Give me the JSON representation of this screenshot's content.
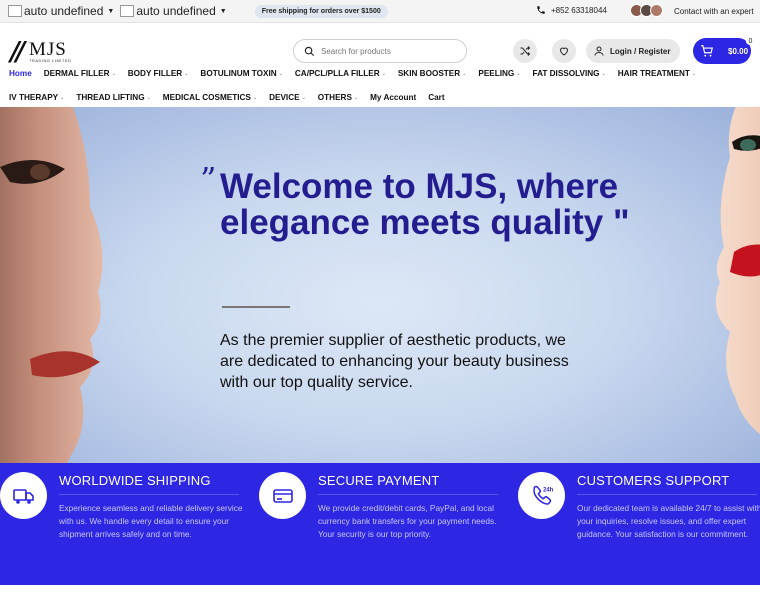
{
  "topbar": {
    "lang1": "auto undefined",
    "lang2": "auto undefined",
    "promo": "Free shipping for orders over $1500",
    "phone": "+852 63318044",
    "contact": "Contact with an expert"
  },
  "header": {
    "logo_name": "MJS",
    "logo_sub": "TRADING LIMITED",
    "search_placeholder": "Search for products",
    "login_label": "Login / Register",
    "cart_amount": "$0.00",
    "cart_count": "0"
  },
  "nav": {
    "row1": [
      {
        "label": "Home",
        "active": true,
        "has_dropdown": false
      },
      {
        "label": "DERMAL FILLER",
        "has_dropdown": true
      },
      {
        "label": "BODY FILLER",
        "has_dropdown": true
      },
      {
        "label": "BOTULINUM TOXIN",
        "has_dropdown": true
      },
      {
        "label": "CA/PCL/PLLA FILLER",
        "has_dropdown": true
      },
      {
        "label": "SKIN BOOSTER",
        "has_dropdown": true
      },
      {
        "label": "PEELING",
        "has_dropdown": true
      },
      {
        "label": "FAT DISSOLVING",
        "has_dropdown": true
      },
      {
        "label": "HAIR TREATMENT",
        "has_dropdown": true
      }
    ],
    "row2": [
      {
        "label": "IV THERAPY",
        "has_dropdown": true
      },
      {
        "label": "THREAD LIFTING",
        "has_dropdown": true
      },
      {
        "label": "MEDICAL COSMETICS",
        "has_dropdown": true
      },
      {
        "label": "DEVICE",
        "has_dropdown": true
      },
      {
        "label": "OTHERS",
        "has_dropdown": true
      },
      {
        "label": "My Account",
        "has_dropdown": false
      },
      {
        "label": "Cart",
        "has_dropdown": false
      }
    ]
  },
  "hero": {
    "quote_open": "”",
    "headline": "Welcome to MJS, where elegance meets quality \"",
    "subtext": "As the premier supplier of aesthetic products, we are dedicated to enhancing your beauty business with our top quality service."
  },
  "features": [
    {
      "icon": "truck-icon",
      "title": "WORLDWIDE SHIPPING",
      "desc": "Experience seamless and reliable delivery service with us. We handle every detail to ensure your shipment arrives safely and on time."
    },
    {
      "icon": "credit-card-icon",
      "title": "SECURE PAYMENT",
      "desc": "We provide credit/debit cards, PayPal, and local currency bank transfers for your payment needs. Your security is our top priority."
    },
    {
      "icon": "support-24h-icon",
      "title": "CUSTOMERS SUPPORT",
      "desc": "Our dedicated team is available 24/7 to assist with your inquiries, resolve issues, and offer expert guidance. Your satisfaction is our commitment."
    }
  ],
  "colors": {
    "brand_blue": "#2d26e3",
    "headline": "#231d8f"
  }
}
